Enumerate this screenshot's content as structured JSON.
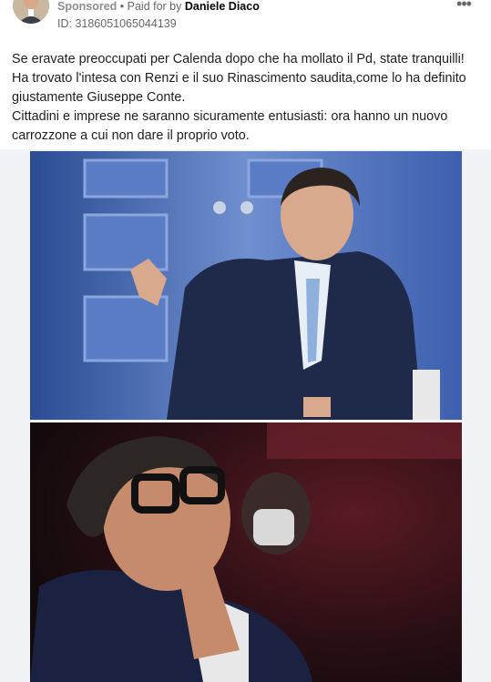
{
  "ad": {
    "sponsored_label": "Sponsored",
    "separator": " • ",
    "paid_for_prefix": "Paid for by ",
    "advertiser_name": "Daniele Diaco",
    "id_text": "ID: 3186051065044139",
    "more_icon": "more-horizontal-icon"
  },
  "post": {
    "paragraph1": "Se eravate preoccupati per Calenda dopo che ha mollato il Pd, state tranquilli! Ha trovato l'intesa con Renzi e il suo Rinascimento saudita,come lo ha definito giustamente Giuseppe Conte.",
    "paragraph2": "Cittadini e imprese ne saranno sicuramente entusiasti: ora hanno un nuovo carrozzone a cui non dare il proprio voto."
  }
}
